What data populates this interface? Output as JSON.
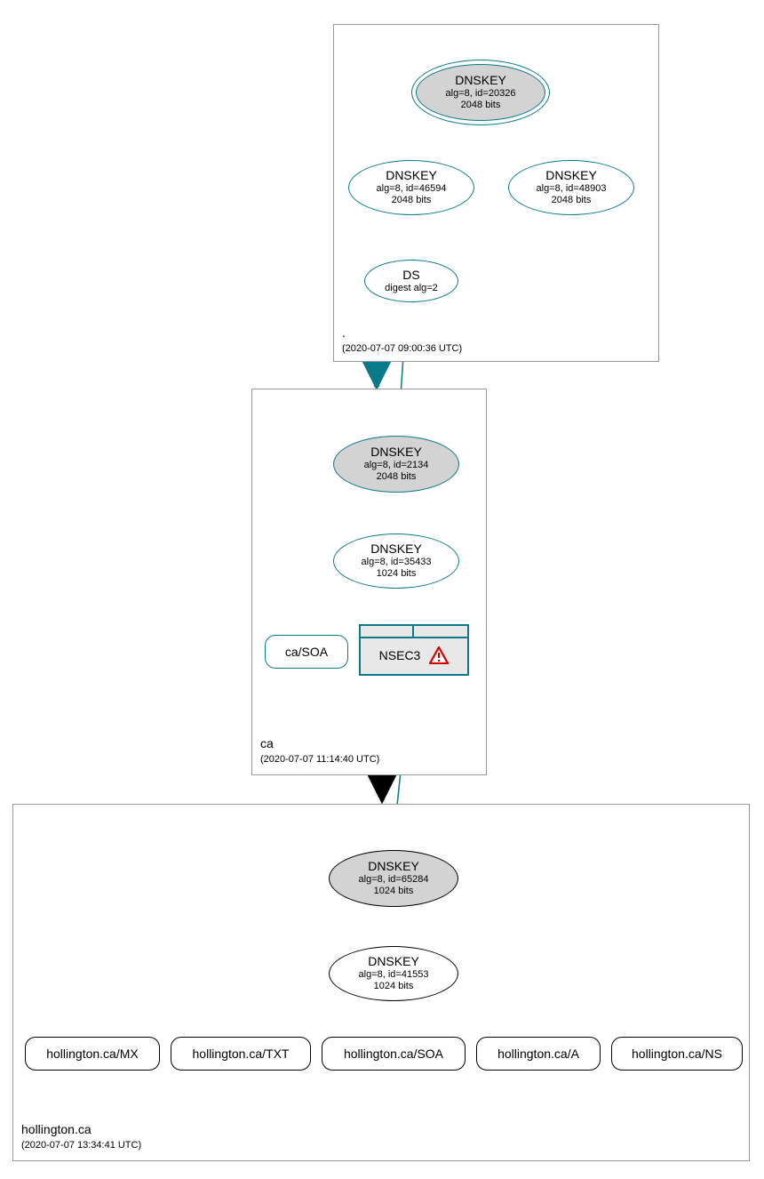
{
  "colors": {
    "teal": "#0a7a8a",
    "grayFill": "#d3d3d3",
    "lightGray": "#e8e8e8",
    "black": "#000000",
    "red": "#d00000"
  },
  "zones": {
    "root": {
      "name": ".",
      "timestamp": "(2020-07-07 09:00:36 UTC)",
      "nodes": {
        "ksk": {
          "title": "DNSKEY",
          "sub1": "alg=8, id=20326",
          "sub2": "2048 bits"
        },
        "zsk1": {
          "title": "DNSKEY",
          "sub1": "alg=8, id=46594",
          "sub2": "2048 bits"
        },
        "zsk2": {
          "title": "DNSKEY",
          "sub1": "alg=8, id=48903",
          "sub2": "2048 bits"
        },
        "ds": {
          "title": "DS",
          "sub1": "digest alg=2"
        }
      }
    },
    "ca": {
      "name": "ca",
      "timestamp": "(2020-07-07 11:14:40 UTC)",
      "nodes": {
        "ksk": {
          "title": "DNSKEY",
          "sub1": "alg=8, id=2134",
          "sub2": "2048 bits"
        },
        "zsk": {
          "title": "DNSKEY",
          "sub1": "alg=8, id=35433",
          "sub2": "1024 bits"
        },
        "soa": {
          "label": "ca/SOA"
        },
        "nsec3": {
          "label": "NSEC3"
        }
      }
    },
    "hollington": {
      "name": "hollington.ca",
      "timestamp": "(2020-07-07 13:34:41 UTC)",
      "nodes": {
        "ksk": {
          "title": "DNSKEY",
          "sub1": "alg=8, id=65284",
          "sub2": "1024 bits"
        },
        "zsk": {
          "title": "DNSKEY",
          "sub1": "alg=8, id=41553",
          "sub2": "1024 bits"
        },
        "rr": {
          "mx": "hollington.ca/MX",
          "txt": "hollington.ca/TXT",
          "soa": "hollington.ca/SOA",
          "a": "hollington.ca/A",
          "ns": "hollington.ca/NS"
        }
      }
    }
  }
}
